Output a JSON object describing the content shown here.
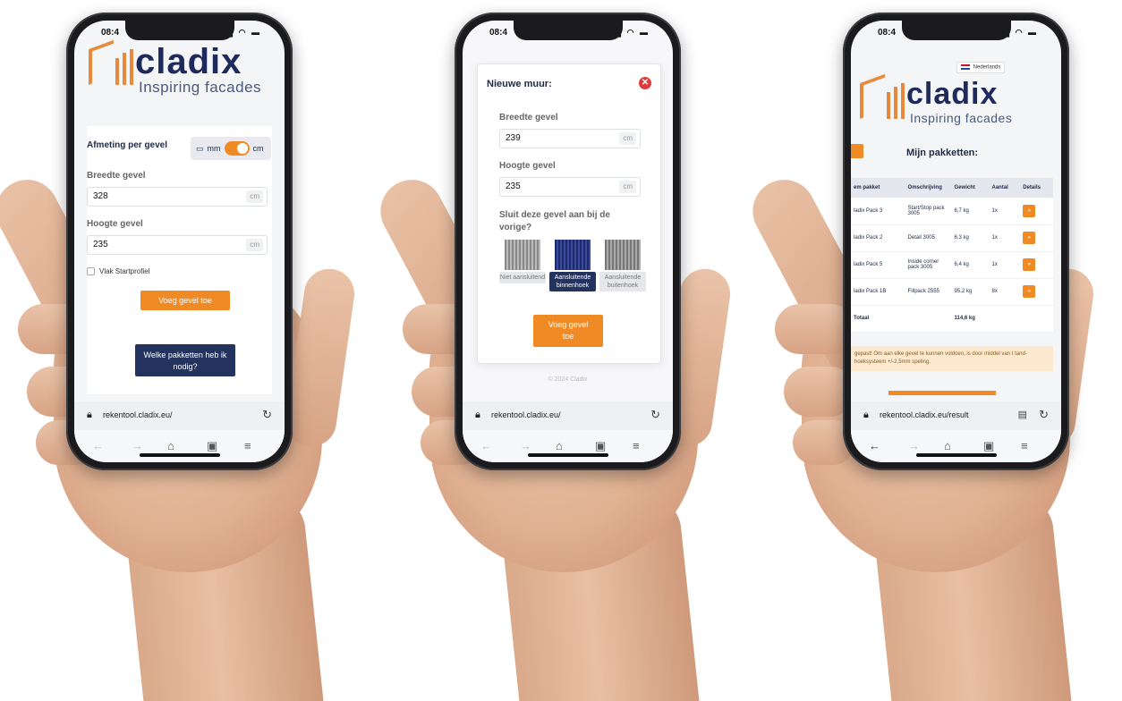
{
  "brand": {
    "name": "cladix",
    "tagline": "Inspiring facades"
  },
  "colors": {
    "accent": "#f08a24",
    "navy": "#24325e",
    "logo_orange": "#e88a3d",
    "danger": "#e03a3a"
  },
  "status_time": "08:4",
  "phone1": {
    "section_title": "Afmeting per gevel",
    "unit_toggle": {
      "left": "mm",
      "right": "cm",
      "selected": "cm"
    },
    "width_label": "Breedte gevel",
    "width_value": "328",
    "width_unit": "cm",
    "height_label": "Hoogte gevel",
    "height_value": "235",
    "height_unit": "cm",
    "checkbox_label": "Vlak Startprofiel",
    "add_button": "Voeg gevel toe",
    "packages_button": "Welke pakketten heb ik nodig?",
    "url": "rekentool.cladix.eu/"
  },
  "phone2": {
    "modal_title": "Nieuwe muur:",
    "width_label": "Breedte gevel",
    "width_value": "239",
    "width_unit": "cm",
    "height_label": "Hoogte gevel",
    "height_value": "235",
    "height_unit": "cm",
    "question": "Sluit deze gevel aan bij de vorige?",
    "options": [
      {
        "label": "Niet aansluitend",
        "selected": false
      },
      {
        "label": "Aansluitende binnenhoek",
        "selected": true
      },
      {
        "label": "Aansluitende buitenhoek",
        "selected": false
      }
    ],
    "add_button": "Voeg gevel toe",
    "footer": "© 2024 Cladix",
    "url": "rekentool.cladix.eu/"
  },
  "phone3": {
    "language": "Nederlands",
    "title": "Mijn pakketten:",
    "columns": [
      "em pakket",
      "Omschrijving",
      "Gewicht",
      "Aantal",
      "Details"
    ],
    "rows": [
      {
        "pakket": "ladix Pack 3",
        "omschrijving": "Start/Stop pack 3005",
        "gewicht": "6,7 kg",
        "aantal": "1x"
      },
      {
        "pakket": "ladix Pack 2",
        "omschrijving": "Detail 3005",
        "gewicht": "6,3 kg",
        "aantal": "1x"
      },
      {
        "pakket": "ladix Pack 5",
        "omschrijving": "Inside corner pack 3005",
        "gewicht": "6,4 kg",
        "aantal": "1x"
      },
      {
        "pakket": "ladix Pack 1B",
        "omschrijving": "Fillpack 2555",
        "gewicht": "95,2 kg",
        "aantal": "8x"
      }
    ],
    "total_label": "Totaal",
    "total_weight": "114,6 kg",
    "notice": "gepast! Om aan elke gevel te kunnen voldoen, is door middel van t tand-hoeksysteem +/-2,5mm speling.",
    "url": "rekentool.cladix.eu/result"
  }
}
